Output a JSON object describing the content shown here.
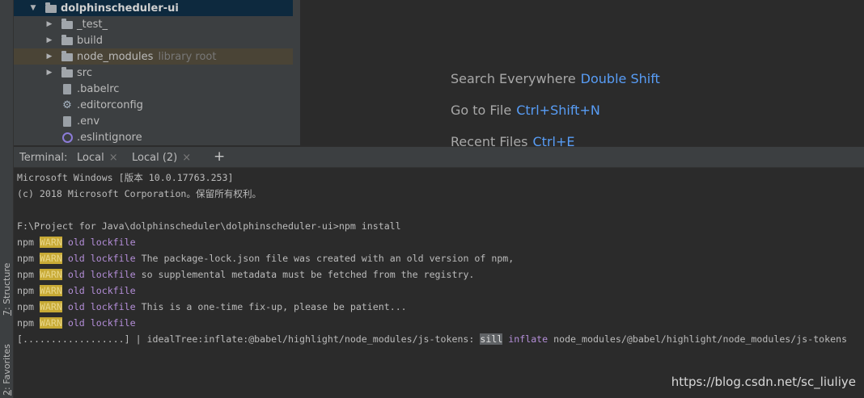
{
  "side_tabs": {
    "structure": {
      "num": "7",
      "label": ": Structure"
    },
    "favorites": {
      "num": "2",
      "label": ": Favorites"
    }
  },
  "project_tree": {
    "root": "dolphinscheduler-ui",
    "items": [
      {
        "label": "_test_",
        "suffix": ""
      },
      {
        "label": "build",
        "suffix": ""
      },
      {
        "label": "node_modules",
        "suffix": "library root"
      },
      {
        "label": "src",
        "suffix": ""
      },
      {
        "label": ".babelrc",
        "suffix": ""
      },
      {
        "label": ".editorconfig",
        "suffix": ""
      },
      {
        "label": ".env",
        "suffix": ""
      },
      {
        "label": ".eslintignore",
        "suffix": ""
      }
    ]
  },
  "editor_hints": [
    {
      "label": "Search Everywhere",
      "shortcut": "Double Shift"
    },
    {
      "label": "Go to File",
      "shortcut": "Ctrl+Shift+N"
    },
    {
      "label": "Recent Files",
      "shortcut": "Ctrl+E"
    }
  ],
  "terminal": {
    "title": "Terminal:",
    "tabs": [
      {
        "label": "Local",
        "close": "×"
      },
      {
        "label": "Local (2)",
        "close": "×"
      }
    ],
    "add": "+",
    "lines": {
      "l1": "Microsoft Windows [版本 10.0.17763.253]",
      "l2": "(c) 2018 Microsoft Corporation。保留所有权利。",
      "l3": "F:\\Project for Java\\dolphinscheduler\\dolphinscheduler-ui>npm install",
      "npm": "npm",
      "warn": "WARN",
      "oldlock": "old lockfile",
      "w2": " The package-lock.json file was created with an old version of npm,",
      "w3": " so supplemental metadata must be fetched from the registry.",
      "w5": " This is a one-time fix-up, please be patient...",
      "prog": "[..................] | idealTree:inflate:@babel/highlight/node_modules/js-tokens: ",
      "sill": "sill",
      "inflate": " inflate",
      "path": " node_modules/@babel/highlight/node_modules/js-tokens"
    }
  },
  "watermark": "https://blog.csdn.net/sc_liuliye"
}
